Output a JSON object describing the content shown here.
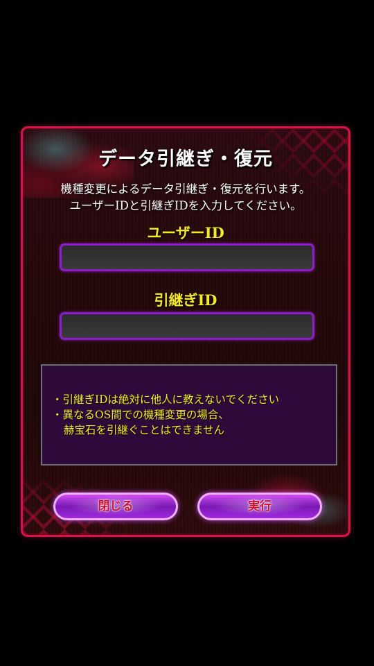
{
  "dialog": {
    "title": "データ引継ぎ・復元",
    "description_line1": "機種変更によるデータ引継ぎ・復元を行います。",
    "description_line2": "ユーザーIDと引継ぎIDを入力してください。",
    "user_id": {
      "label": "ユーザーID",
      "value": "",
      "placeholder": ""
    },
    "transfer_id": {
      "label": "引継ぎID",
      "value": "",
      "placeholder": ""
    },
    "notice": {
      "line1": "・引継ぎIDは絶対に他人に教えないでください",
      "line2": "・異なるOS間での機種変更の場合、",
      "line3": "赫宝石を引継ぐことはできません"
    },
    "buttons": {
      "close_label": "閉じる",
      "execute_label": "実行"
    }
  },
  "colors": {
    "border": "#d4144a",
    "label_yellow": "#f4ea2c",
    "button_purple": "#a02ae0",
    "button_text": "#c8102e",
    "notice_bg": "#2e0a3a"
  }
}
